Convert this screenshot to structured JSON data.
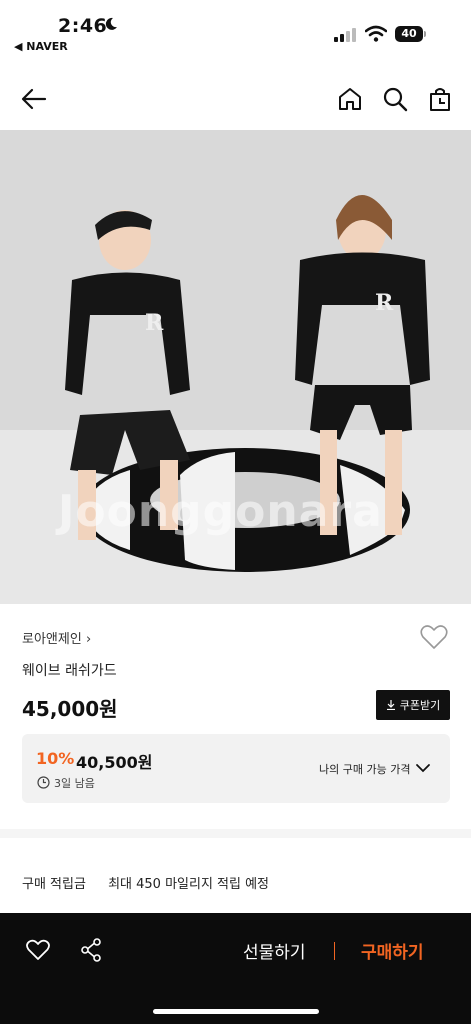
{
  "status": {
    "time": "2:46",
    "back_app": "◀ NAVER",
    "battery": "40"
  },
  "product": {
    "brand": "로아앤제인",
    "brand_chevron": "›",
    "title": "웨이브 래쉬가드",
    "price": "45,000원",
    "coupon_label": "쿠폰받기",
    "image_watermark": "Joonggonara"
  },
  "deal": {
    "discount": "10%",
    "price": "40,500원",
    "remaining": "3일 남음",
    "my_price_label": "나의 구매 가능 가격"
  },
  "points": {
    "label": "구매 적립금",
    "value": "최대 450 마일리지 적립 예정"
  },
  "bottom_bar": {
    "gift_label": "선물하기",
    "buy_label": "구매하기"
  },
  "colors": {
    "accent": "#f26522",
    "bottom_bar": "#0c0c0c",
    "deal_bg": "#f2f2f2"
  },
  "icons": [
    "moon-icon",
    "signal-icon",
    "wifi-icon",
    "battery-icon",
    "back-arrow-icon",
    "home-icon",
    "search-icon",
    "shopping-bag-icon",
    "heart-icon",
    "download-icon",
    "clock-icon",
    "chevron-down-icon",
    "share-icon"
  ]
}
